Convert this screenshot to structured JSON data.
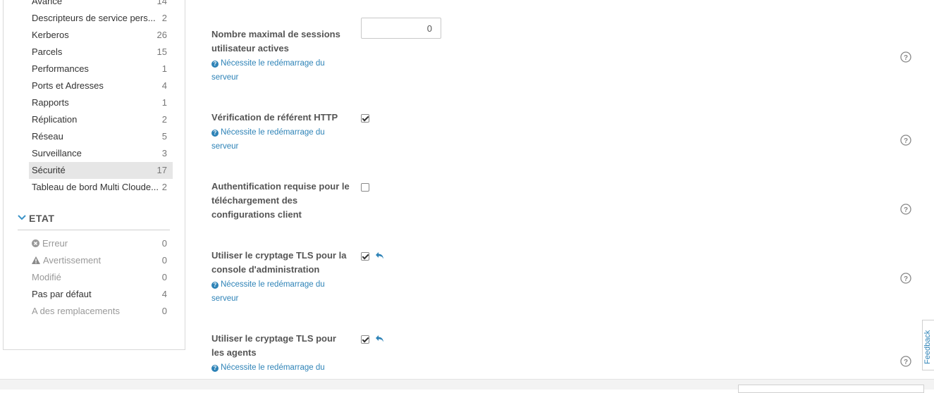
{
  "sidebar": {
    "categories": [
      {
        "label": "Avancé",
        "count": "14"
      },
      {
        "label": "Descripteurs de service pers...",
        "count": "2"
      },
      {
        "label": "Kerberos",
        "count": "26"
      },
      {
        "label": "Parcels",
        "count": "15"
      },
      {
        "label": "Performances",
        "count": "1"
      },
      {
        "label": "Ports et Adresses",
        "count": "4"
      },
      {
        "label": "Rapports",
        "count": "1"
      },
      {
        "label": "Réplication",
        "count": "2"
      },
      {
        "label": "Réseau",
        "count": "5"
      },
      {
        "label": "Surveillance",
        "count": "3"
      },
      {
        "label": "Sécurité",
        "count": "17"
      },
      {
        "label": "Tableau de bord Multi Cloude...",
        "count": "2"
      }
    ],
    "etat": {
      "title": "ETAT",
      "items": [
        {
          "label": "Erreur",
          "count": "0",
          "icon": "error-icon"
        },
        {
          "label": "Avertissement",
          "count": "0",
          "icon": "warning-icon"
        },
        {
          "label": "Modifié",
          "count": "0"
        },
        {
          "label": "Pas par défaut",
          "count": "4"
        },
        {
          "label": "A des remplacements",
          "count": "0"
        }
      ]
    }
  },
  "restart_note": "Nécessite le redémarrage du serveur",
  "settings": [
    {
      "name": "Nombre maximal de sessions utilisateur actives",
      "value": "0",
      "restart": true
    },
    {
      "name": "Vérification de référent HTTP",
      "checked": true,
      "restart": true
    },
    {
      "name": "Authentification requise pour le téléchargement des configurations client",
      "checked": false,
      "restart": false
    },
    {
      "name": "Utiliser le cryptage TLS pour la console d'administration",
      "checked": true,
      "restart": true,
      "undo": true
    },
    {
      "name": "Utiliser le cryptage TLS pour les agents",
      "checked": true,
      "restart": true,
      "undo": true
    }
  ],
  "feedback_label": "Feedback",
  "colors": {
    "accent": "#2e83b7",
    "active_bg": "#e6e6e6"
  }
}
